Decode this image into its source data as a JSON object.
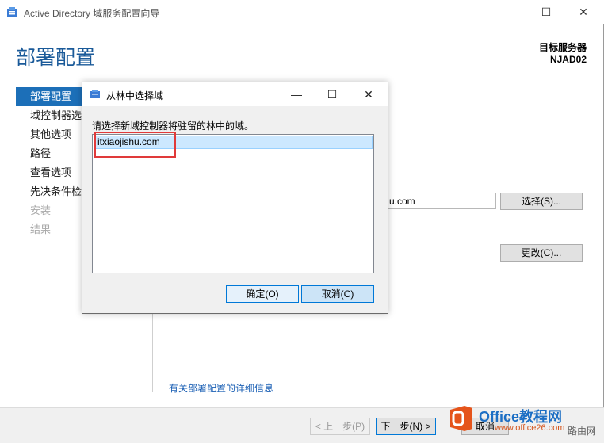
{
  "window": {
    "title": "Active Directory 域服务配置向导",
    "minimize": "—",
    "maximize": "☐",
    "close": "✕"
  },
  "header": {
    "page_title": "部署配置",
    "target_label": "目标服务器",
    "target_server": "NJAD02"
  },
  "nav": {
    "items": [
      {
        "label": "部署配置",
        "state": "active"
      },
      {
        "label": "域控制器选项",
        "state": "normal"
      },
      {
        "label": "其他选项",
        "state": "normal"
      },
      {
        "label": "路径",
        "state": "normal"
      },
      {
        "label": "查看选项",
        "state": "normal"
      },
      {
        "label": "先决条件检查",
        "state": "normal"
      },
      {
        "label": "安装",
        "state": "disabled"
      },
      {
        "label": "结果",
        "state": "disabled"
      }
    ]
  },
  "main": {
    "domain_field_value": "u.com",
    "select_button": "选择(S)...",
    "change_button": "更改(C)...",
    "more_info_link": "有关部署配置的详细信息"
  },
  "footer": {
    "prev_button": "< 上一步(P)",
    "next_button": "下一步(N) >",
    "cancel_partial": "取消"
  },
  "dialog": {
    "title": "从林中选择域",
    "minimize": "—",
    "maximize": "☐",
    "close": "✕",
    "prompt": "请选择新域控制器将驻留的林中的域。",
    "domains": [
      "itxiaojishu.com"
    ],
    "ok_button": "确定(O)",
    "cancel_button": "取消(C)"
  },
  "watermark": {
    "brand": "Office教程网",
    "url": "www.office26.com",
    "extra": "路由网"
  },
  "colors": {
    "accent": "#1c6fb8",
    "title_blue": "#1a5a99",
    "highlight_red": "#e03a3a",
    "selection": "#cce8ff"
  }
}
